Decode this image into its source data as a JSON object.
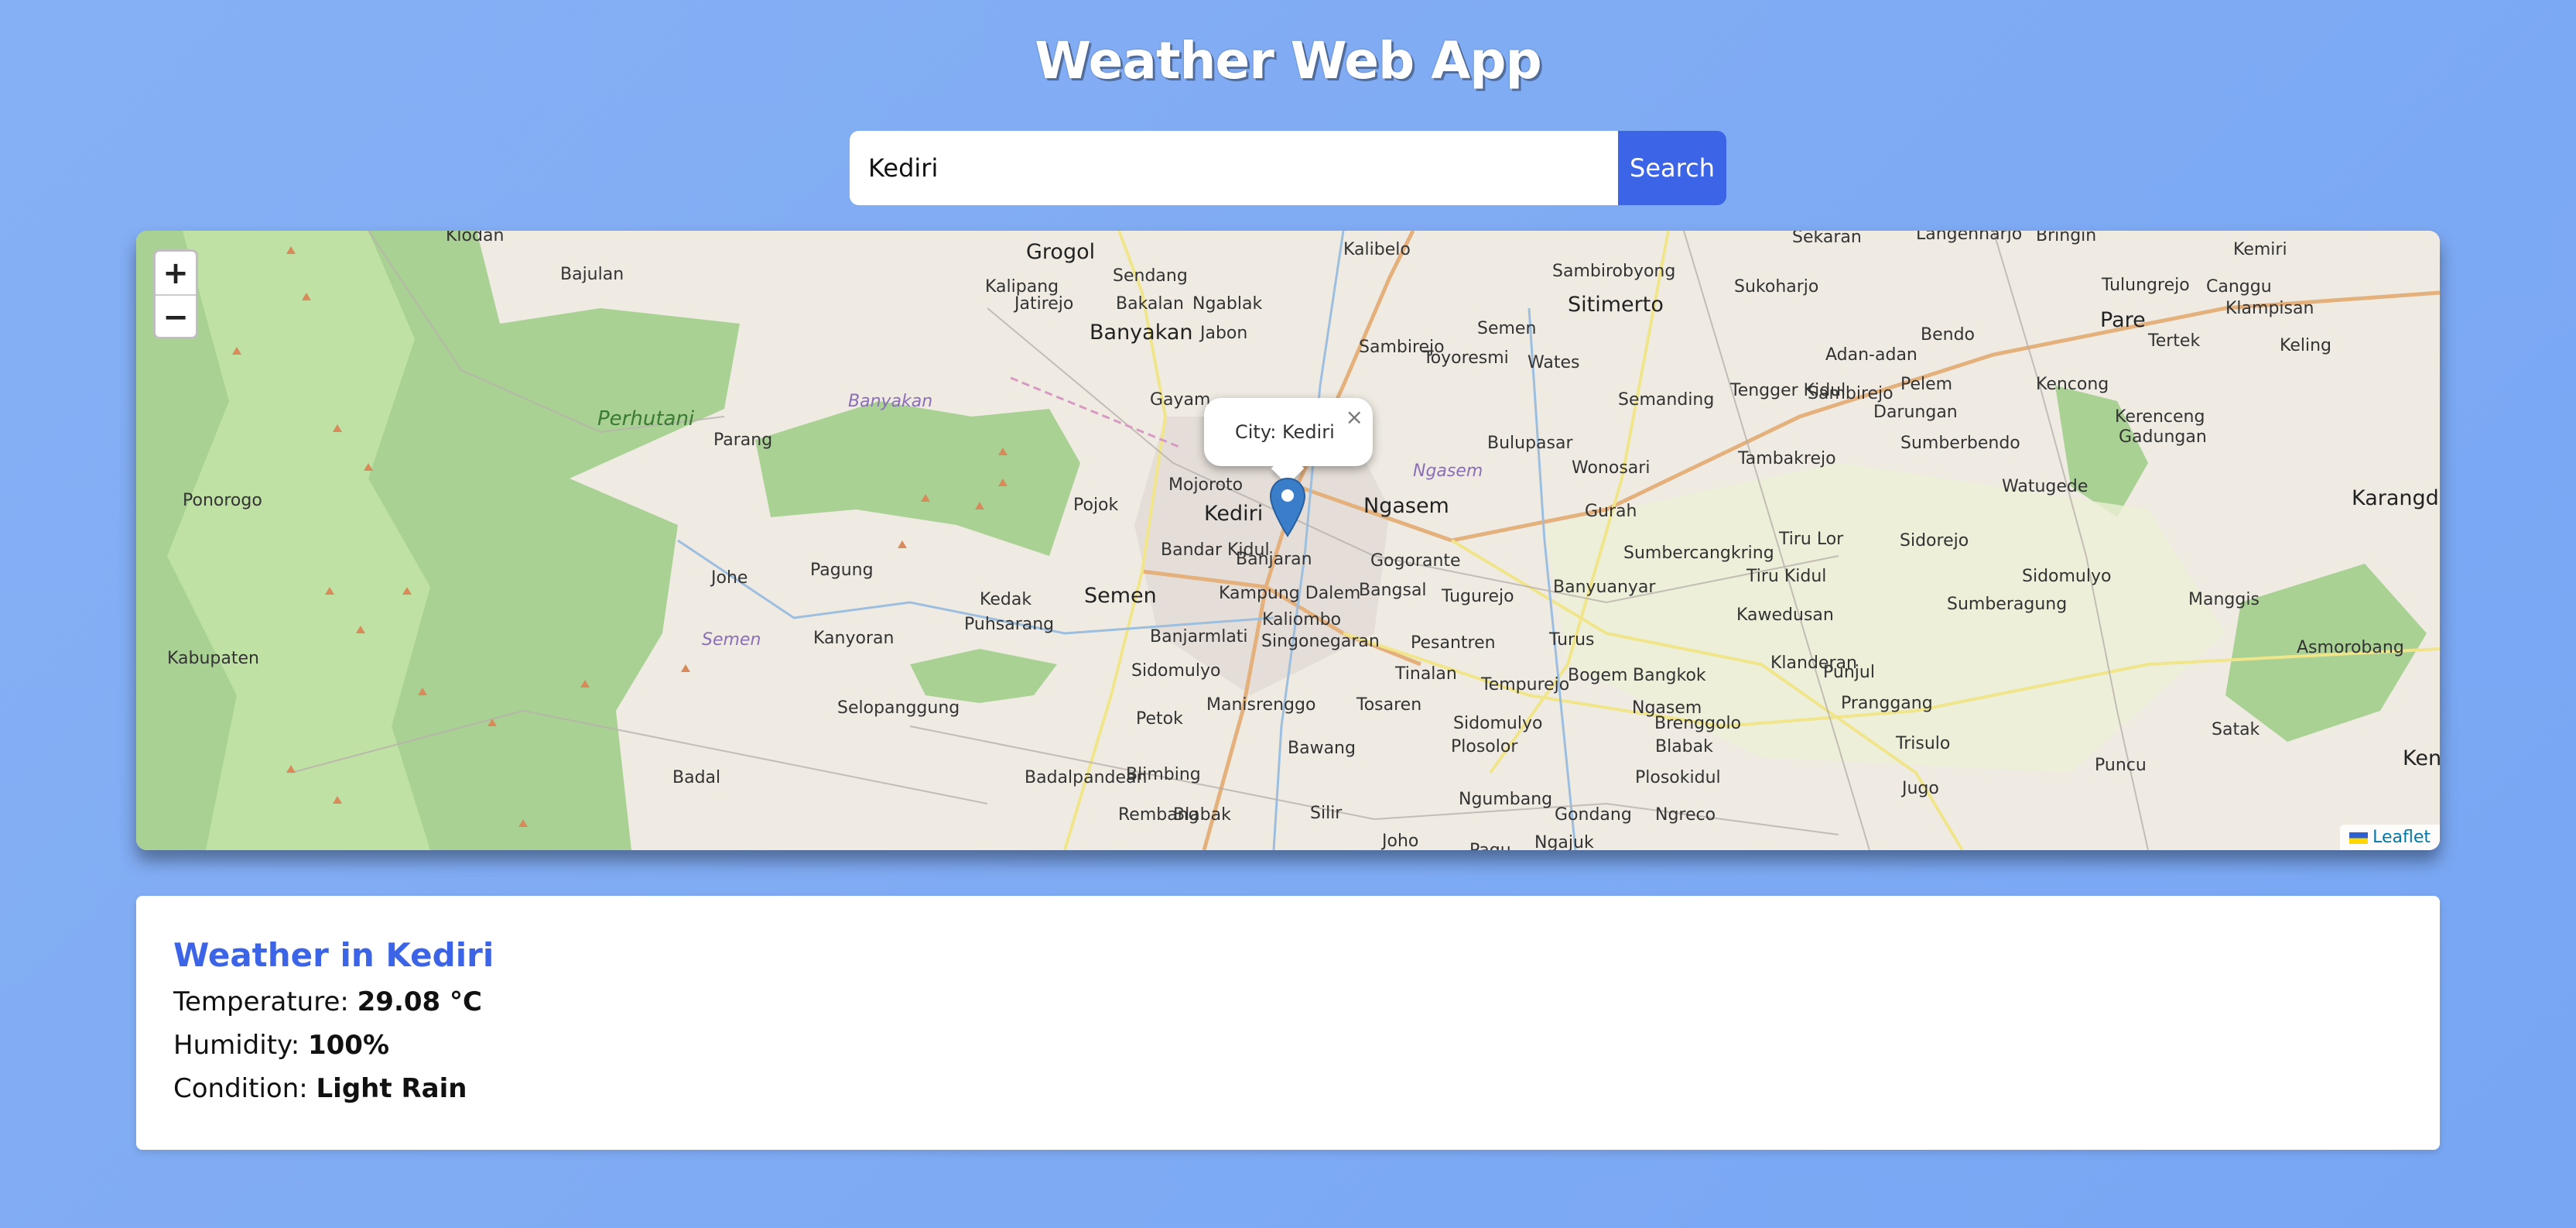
{
  "app": {
    "title": "Weather Web App"
  },
  "search": {
    "value": "Kediri",
    "button_label": "Search"
  },
  "map": {
    "zoom_in_label": "+",
    "zoom_out_label": "−",
    "popup_text": "City: Kediri",
    "popup_close": "×",
    "attribution": "Leaflet",
    "labels": [
      "Klodan",
      "Bajulan",
      "Grogol",
      "Sendang",
      "Kalipang",
      "Jatirejo",
      "Bakalan",
      "Ngablak",
      "Banyakan",
      "Jabon",
      "Kalibelo",
      "Sambirejo",
      "Sambirobyong",
      "Sitimerto",
      "Sekaran",
      "Sukoharjo",
      "Langenharjo",
      "Bringin",
      "Kemiri",
      "Tulungrejo",
      "Canggu",
      "Pare",
      "Klampisan",
      "Tertek",
      "Keling",
      "Perhutani",
      "Banyakan",
      "Parang",
      "Gayam",
      "Semen",
      "Toyoresmi",
      "Wates",
      "Semanding",
      "Tengger Kidul",
      "Adan-adan",
      "Bendo",
      "Pelem",
      "Darungan",
      "Sambirejo",
      "Kencong",
      "Kerenceng",
      "Gadungan",
      "Pojok",
      "Mojoroto",
      "Kediri",
      "Ngasem",
      "Ngasem",
      "Bulupasar",
      "Wonosari",
      "Tambakrejo",
      "Sumberbendo",
      "Watugede",
      "Karangdinoyo",
      "Gurah",
      "Tiru Lor",
      "Sidorejo",
      "Sumbercangkring",
      "Tiru Kidul",
      "Sidomulyo",
      "Johe",
      "Pagung",
      "Bandar Kidul",
      "Banjaran",
      "Gogorante",
      "Kedak",
      "Bangsal",
      "Tugurejo",
      "Banyuanyar",
      "Kawedusan",
      "Sumberagung",
      "Manggis",
      "Semen",
      "Kampung Dalem",
      "Puhsarang",
      "Banjarmlati",
      "Kaliombo",
      "Semen",
      "Kanyoran",
      "Singonegaran",
      "Pesantren",
      "Turus",
      "Klanderan",
      "Asmorobang",
      "Sidomulyo",
      "Tinalan",
      "Bogem",
      "Bangkok",
      "Punjul",
      "Selopanggung",
      "Manisrenggo",
      "Tosaren",
      "Tempurejo",
      "Ngasem",
      "Pranggang",
      "Satak",
      "Petok",
      "Sidomulyo",
      "Brenggolo",
      "Blabak",
      "Bawang",
      "Plosolor",
      "Trisulo",
      "Puncu",
      "Keniten",
      "Badalpandean",
      "Blimbing",
      "Plosokidul",
      "Jugo",
      "Badal",
      "Rembang",
      "Blabak",
      "Silir",
      "Ngumbang",
      "Gondang",
      "Ngreco",
      "Joho",
      "Pagu",
      "Ngajuk",
      "Ponorogo",
      "Kabupaten"
    ]
  },
  "weather": {
    "heading": "Weather in Kediri",
    "temperature_label": "Temperature:",
    "temperature_value": "29.08 °C",
    "humidity_label": "Humidity:",
    "humidity_value": "100%",
    "condition_label": "Condition:",
    "condition_value": "Light Rain"
  },
  "colors": {
    "background": "#7faaf4",
    "accent": "#3c64e6",
    "marker": "#3a7dc8"
  },
  "icons": {
    "zoom_in": "plus-icon",
    "zoom_out": "minus-icon",
    "marker": "map-marker-icon",
    "close": "close-icon"
  }
}
